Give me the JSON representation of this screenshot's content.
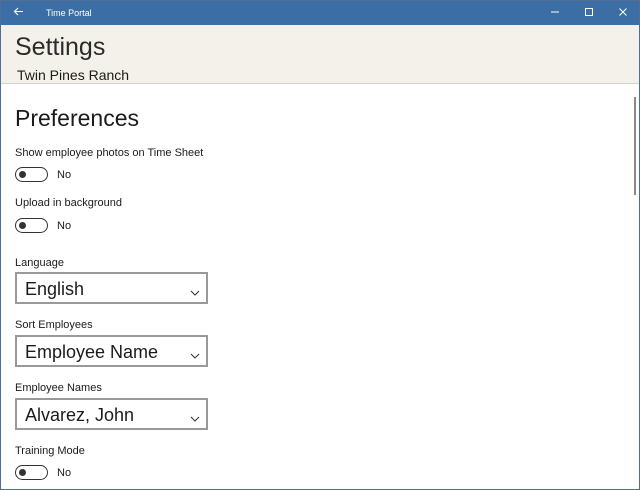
{
  "window": {
    "app_title": "Time Portal",
    "icons": {
      "back": "arrow-left-icon",
      "minimize": "minimize-icon",
      "maximize": "maximize-icon",
      "close": "close-icon"
    },
    "titlebar_color": "#3a6ea5"
  },
  "header": {
    "title": "Settings",
    "subtitle": "Twin Pines Ranch"
  },
  "preferences": {
    "section_title": "Preferences",
    "show_photos": {
      "label": "Show employee photos on Time Sheet",
      "state": "No",
      "on": false
    },
    "upload_background": {
      "label": "Upload in background",
      "state": "No",
      "on": false
    },
    "language": {
      "label": "Language",
      "value": "English"
    },
    "sort_employees": {
      "label": "Sort Employees",
      "value": "Employee Name"
    },
    "employee_names": {
      "label": "Employee Names",
      "value": "Alvarez, John"
    },
    "training_mode": {
      "label": "Training Mode",
      "state": "No",
      "on": false
    }
  }
}
